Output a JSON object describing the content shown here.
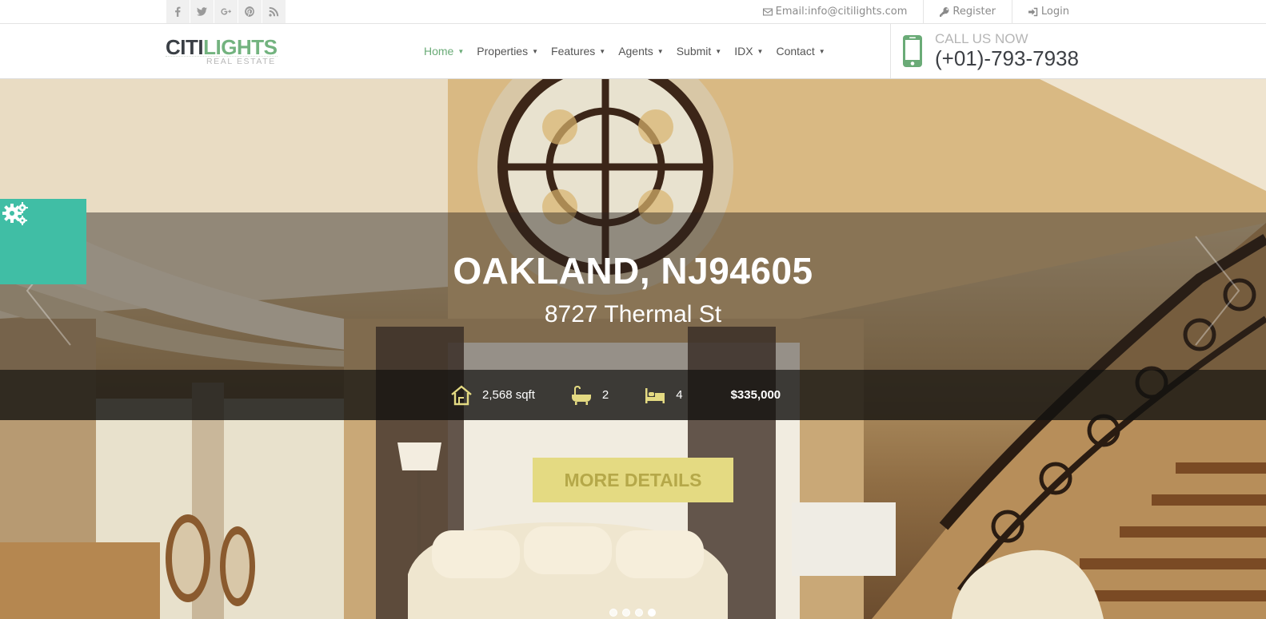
{
  "topbar": {
    "socials": [
      {
        "icon": "facebook-icon",
        "glyph": "f"
      },
      {
        "icon": "twitter-icon",
        "glyph": "t"
      },
      {
        "icon": "google-plus-icon",
        "glyph": "g+"
      },
      {
        "icon": "pinterest-icon",
        "glyph": "p"
      },
      {
        "icon": "rss-icon",
        "glyph": "rss"
      }
    ],
    "email": "Email:info@citilights.com",
    "register": "Register",
    "login": "Login"
  },
  "header": {
    "logo_part1": "CITI",
    "logo_part2": "LIGHTS",
    "logo_sub": "REAL ESTATE",
    "nav": [
      {
        "label": "Home",
        "active": true
      },
      {
        "label": "Properties"
      },
      {
        "label": "Features"
      },
      {
        "label": "Agents"
      },
      {
        "label": "Submit"
      },
      {
        "label": "IDX"
      },
      {
        "label": "Contact"
      }
    ],
    "call_label": "CALL US NOW",
    "call_number": "(+01)-793-7938"
  },
  "hero": {
    "title": "OAKLAND, NJ94605",
    "address": "8727 Thermal St",
    "area": "2,568 sqft",
    "baths": "2",
    "beds": "4",
    "price": "$335,000",
    "button": "MORE DETAILS",
    "slides": 4,
    "active_slide": 4
  },
  "colors": {
    "accent": "#6aab77",
    "teal_panel": "#40bea5",
    "button_bg": "#e4da82",
    "button_text": "#b5a849"
  }
}
